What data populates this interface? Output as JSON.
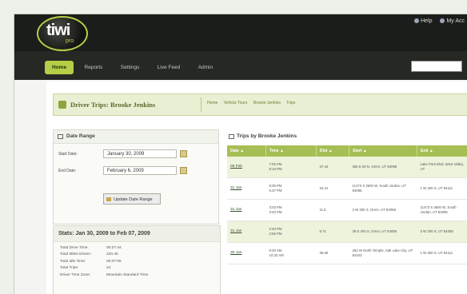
{
  "app": {
    "logo_text": "tiwi",
    "logo_sub": "pro",
    "top_links": [
      "Help",
      "My Acc"
    ]
  },
  "nav": {
    "items": [
      "Home",
      "Reports",
      "Settings",
      "Live Feed",
      "Admin"
    ]
  },
  "title": {
    "heading": "Driver Trips: Brooke Jenkins",
    "links": [
      "Home",
      "Vehicle Tours",
      "Brooke Jenkins",
      "Trips"
    ]
  },
  "date_range": {
    "header": "Date Range",
    "start_label": "Start Date:",
    "start_value": "January 30, 2009",
    "end_label": "End Date:",
    "end_value": "February 6, 2009",
    "button": "Update Date Range"
  },
  "stats": {
    "header": "Stats: Jan 30, 2009 to Feb 07, 2009",
    "rows": [
      {
        "label": "Total Drive Time:",
        "value": "00:27:44"
      },
      {
        "label": "Total Miles Driven:",
        "value": "220.45"
      },
      {
        "label": "Total Idle Time:",
        "value": "00:07:06"
      },
      {
        "label": "Total Trips:",
        "value": "24"
      },
      {
        "label": "Driver Time Zone:",
        "value": "Mountain Standard Time"
      }
    ]
  },
  "trips": {
    "header": "Trips by Brooke Jenkins",
    "columns": [
      "Date ▲",
      "Time ▲",
      "Dist ▲",
      "Start ▲",
      "End ▲"
    ],
    "rows": [
      {
        "date": "06 Feb",
        "time1": "7:05 PM",
        "time2": "8:15 PM",
        "dist": "37.44",
        "start": "255 E 50 N, Orem, UT 84058",
        "end": "Lake Park Blvd, West Valley, UT"
      },
      {
        "date": "31 Jan",
        "time1": "5:05 PM",
        "time2": "5:37 PM",
        "dist": "16.41",
        "start": "11473 S 3600 W, South Jordan, UT 84095",
        "end": "1 W 300 S, UT 84111"
      },
      {
        "date": "31 Jan",
        "time1": "3:03 PM",
        "time2": "3:20 PM",
        "dist": "11.5",
        "start": "3 W 300 S, Orem, UT 84058",
        "end": "11473 S 3600 W, South Jordan, UT 84095"
      },
      {
        "date": "31 Jan",
        "time1": "2:40 PM",
        "time2": "2:55 PM",
        "dist": "8.71",
        "start": "35 E 400 S, Orem, UT 84058",
        "end": "3 W 300 S, UT 84058"
      },
      {
        "date": "30 Jan",
        "time1": "9:30 AM",
        "time2": "10:32 AM",
        "dist": "36.86",
        "start": "252 W North Temple, Salt Lake City, UT 84103",
        "end": "1 W 300 S, UT 84111"
      }
    ]
  }
}
